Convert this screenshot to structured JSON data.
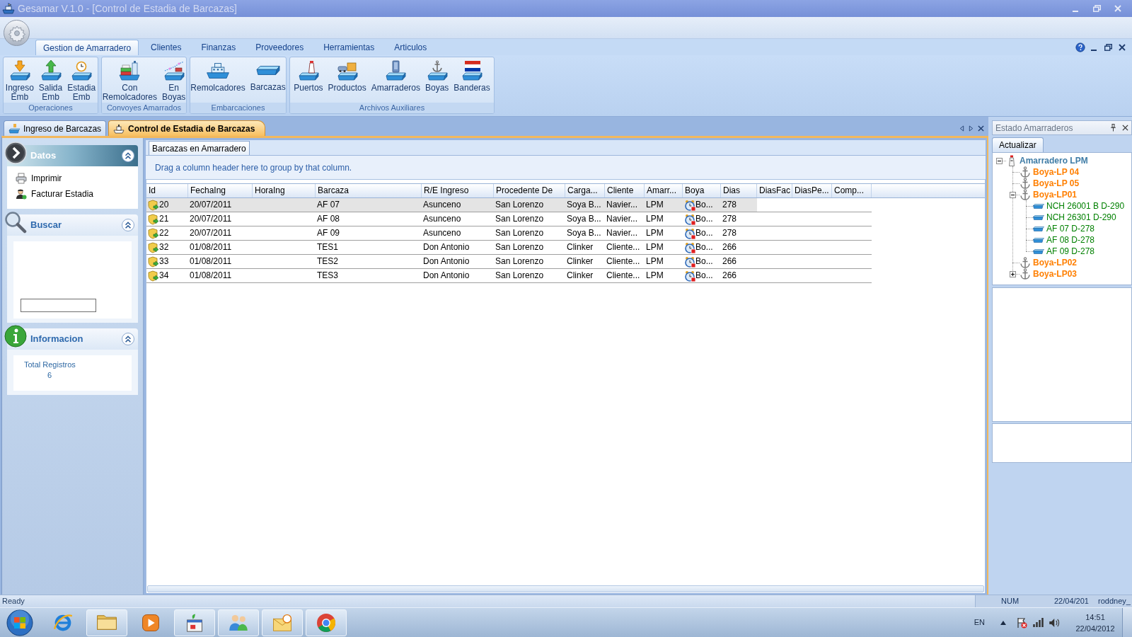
{
  "window": {
    "title": "Gesamar V.1.0 - [Control de Estadia de Barcazas]"
  },
  "ribbon": {
    "tabs": [
      {
        "label": "Gestion de Amarradero",
        "selected": true
      },
      {
        "label": "Clientes",
        "selected": false
      },
      {
        "label": "Finanzas",
        "selected": false
      },
      {
        "label": "Proveedores",
        "selected": false
      },
      {
        "label": "Herramientas",
        "selected": false
      },
      {
        "label": "Articulos",
        "selected": false
      }
    ],
    "groups": [
      {
        "label": "Operaciones",
        "buttons": [
          "Ingreso Emb",
          "Salida Emb",
          "Estadia Emb"
        ]
      },
      {
        "label": "Convoyes Amarrados",
        "buttons": [
          "Con Remolcadores",
          "En Boyas"
        ]
      },
      {
        "label": "Embarcaciones",
        "buttons": [
          "Remolcadores",
          "Barcazas"
        ]
      },
      {
        "label": "Archivos Auxiliares",
        "buttons": [
          "Puertos",
          "Productos",
          "Amarraderos",
          "Boyas",
          "Banderas"
        ]
      }
    ]
  },
  "document_tabs": [
    {
      "label": "Ingreso de Barcazas",
      "selected": false
    },
    {
      "label": "Control de Estadia de Barcazas",
      "selected": true
    }
  ],
  "side_panel": [
    {
      "kind": "actions",
      "title": "Datos",
      "selected": true,
      "expanded": true,
      "items": [
        "Imprimir",
        "Facturar Estadia"
      ]
    },
    {
      "kind": "search",
      "title": "Buscar",
      "selected": false,
      "expanded": true
    },
    {
      "kind": "info",
      "title": "Informacion",
      "selected": false,
      "expanded": true,
      "label": "Total Registros",
      "value": "6"
    }
  ],
  "grid": {
    "tab": "Barcazas en Amarradero",
    "group_hint": "Drag a column header here to group by that column.",
    "columns": [
      "Id",
      "FechaIng",
      "HoraIng",
      "Barcaza",
      "R/E Ingreso",
      "Procedente De",
      "Carga...",
      "Cliente",
      "Amarr...",
      "Boya",
      "Dias",
      "DiasFac",
      "DiasPe...",
      "Comp..."
    ],
    "rows": [
      {
        "selected": true,
        "cells": [
          "20",
          "20/07/2011",
          null,
          "AF 07",
          "Asunceno",
          "San Lorenzo",
          "Soya B...",
          "Navier...",
          "LPM",
          "Bo...",
          "278"
        ]
      },
      {
        "selected": false,
        "cells": [
          "21",
          "20/07/2011",
          null,
          "AF 08",
          "Asunceno",
          "San Lorenzo",
          "Soya B...",
          "Navier...",
          "LPM",
          "Bo...",
          "278"
        ]
      },
      {
        "selected": false,
        "cells": [
          "22",
          "20/07/2011",
          null,
          "AF 09",
          "Asunceno",
          "San Lorenzo",
          "Soya B...",
          "Navier...",
          "LPM",
          "Bo...",
          "278"
        ]
      },
      {
        "selected": false,
        "cells": [
          "32",
          "01/08/2011",
          null,
          "TES1",
          "Don Antonio",
          "San Lorenzo",
          "Clinker",
          "Cliente...",
          "LPM",
          "Bo...",
          "266"
        ]
      },
      {
        "selected": false,
        "cells": [
          "33",
          "01/08/2011",
          null,
          "TES2",
          "Don Antonio",
          "San Lorenzo",
          "Clinker",
          "Cliente...",
          "LPM",
          "Bo...",
          "266"
        ]
      },
      {
        "selected": false,
        "cells": [
          "34",
          "01/08/2011",
          null,
          "TES3",
          "Don Antonio",
          "San Lorenzo",
          "Clinker",
          "Cliente...",
          "LPM",
          "Bo...",
          "266"
        ]
      }
    ]
  },
  "status_panel": {
    "title": "Estado Amarraderos",
    "button": "Actualizar",
    "tree": [
      {
        "kind": "amarradero",
        "label": "Amarradero LPM",
        "expanded": true,
        "children": [
          {
            "kind": "boya",
            "label": "Boya-LP 04"
          },
          {
            "kind": "boya",
            "label": "Boya-LP 05"
          },
          {
            "kind": "boya",
            "label": "Boya-LP01",
            "expanded": true,
            "children": [
              {
                "kind": "barcaza",
                "label": "NCH 26001 B D-290"
              },
              {
                "kind": "barcaza",
                "label": "NCH 26301 D-290"
              },
              {
                "kind": "barcaza",
                "label": "AF 07 D-278"
              },
              {
                "kind": "barcaza",
                "label": "AF 08 D-278"
              },
              {
                "kind": "barcaza",
                "label": "AF 09 D-278"
              }
            ]
          },
          {
            "kind": "boya",
            "label": "Boya-LP02"
          },
          {
            "kind": "boya",
            "label": "Boya-LP03",
            "expanded": false
          }
        ]
      }
    ]
  },
  "status_bar": {
    "text": "Ready",
    "indicators": [
      "NUM",
      "22/04/201",
      "roddney_"
    ]
  },
  "taskbar": {
    "apps": [
      {
        "running": false
      },
      {
        "running": true
      },
      {
        "running": false
      },
      {
        "running": true
      },
      {
        "running": true
      },
      {
        "running": true
      },
      {
        "running": true
      }
    ],
    "language": "EN",
    "time": "14:51",
    "date": "22/04/2012"
  }
}
